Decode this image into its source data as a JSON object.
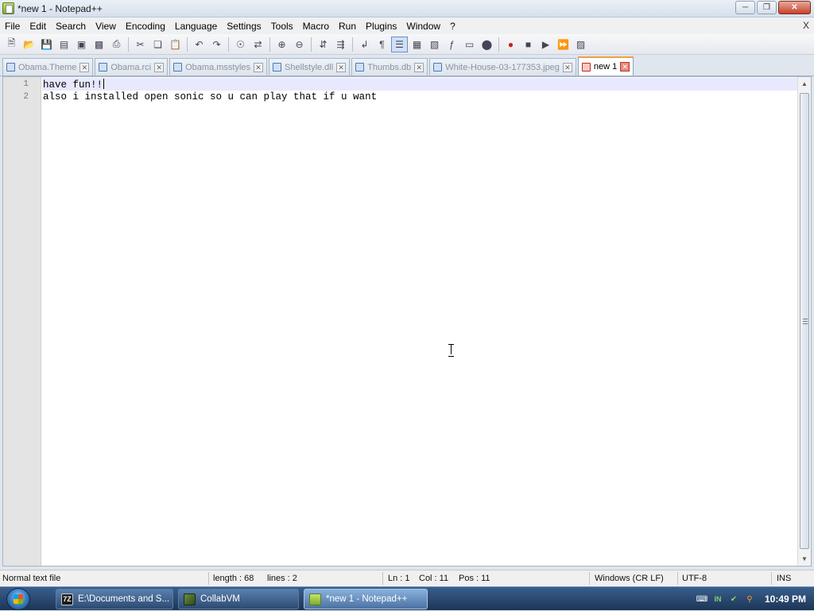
{
  "window": {
    "title": "*new 1 - Notepad++",
    "doc_close": "X"
  },
  "menu": [
    "File",
    "Edit",
    "Search",
    "View",
    "Encoding",
    "Language",
    "Settings",
    "Tools",
    "Macro",
    "Run",
    "Plugins",
    "Window",
    "?"
  ],
  "tabs": [
    {
      "label": "Obama.Theme",
      "active": false
    },
    {
      "label": "Obama.rci",
      "active": false
    },
    {
      "label": "Obama.msstyles",
      "active": false
    },
    {
      "label": "Shellstyle.dll",
      "active": false
    },
    {
      "label": "Thumbs.db",
      "active": false
    },
    {
      "label": "White-House-03-177353.jpeg",
      "active": false
    },
    {
      "label": "new 1",
      "active": true
    }
  ],
  "editor": {
    "lines": [
      {
        "number": "1",
        "text": "have fun!!"
      },
      {
        "number": "2",
        "text": "also i installed open sonic so u can play that if u want"
      }
    ]
  },
  "status": {
    "file_type": "Normal text file",
    "length": "length : 68",
    "lines": "lines : 2",
    "ln": "Ln : 1",
    "col": "Col : 11",
    "pos": "Pos : 11",
    "eol": "Windows (CR LF)",
    "encoding": "UTF-8",
    "mode": "INS"
  },
  "taskbar": {
    "items": [
      {
        "label": "E:\\Documents and S...",
        "icon_text": "7Z",
        "active": false
      },
      {
        "label": "CollabVM",
        "icon_text": "",
        "active": false
      },
      {
        "label": "*new 1 - Notepad++",
        "icon_text": "",
        "active": true
      }
    ],
    "tray_lang": "IN",
    "clock": "10:49 PM"
  },
  "colors": {
    "current_line": "#e8e8ff",
    "active_tab_accent": "#f0a040",
    "taskbar_top": "#3a5f8c"
  }
}
